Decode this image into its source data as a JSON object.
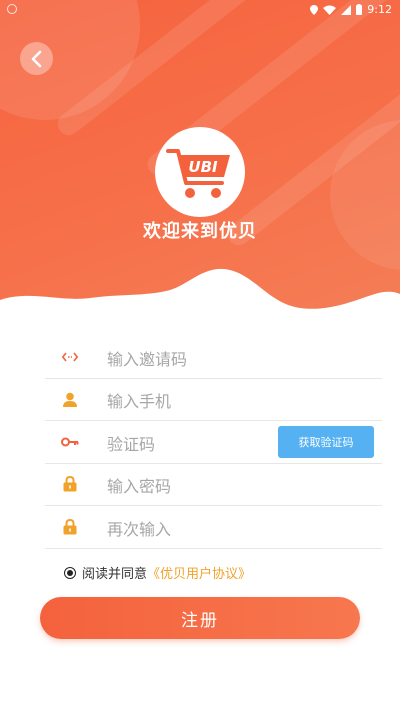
{
  "status_bar": {
    "time": "9:12"
  },
  "header": {
    "welcome": "欢迎来到优贝",
    "logo_text": "UBI"
  },
  "form": {
    "invite_code": {
      "placeholder": "输入邀请码"
    },
    "phone": {
      "placeholder": "输入手机"
    },
    "verify_code": {
      "placeholder": "验证码",
      "button_label": "获取验证码"
    },
    "password": {
      "placeholder": "输入密码"
    },
    "password_repeat": {
      "placeholder": "再次输入"
    }
  },
  "agreement": {
    "prefix": "阅读并同意",
    "link": "《优贝用户协议》",
    "checked": true
  },
  "register_button": {
    "label": "注册"
  },
  "colors": {
    "primary": "#f5633e",
    "accent_blue": "#56b1f2",
    "link": "#f0a22a"
  },
  "icons": {
    "back": "chevron-left-icon",
    "invite": "link-arrows-icon",
    "phone": "person-icon",
    "verify": "key-icon",
    "password": "lock-icon"
  }
}
